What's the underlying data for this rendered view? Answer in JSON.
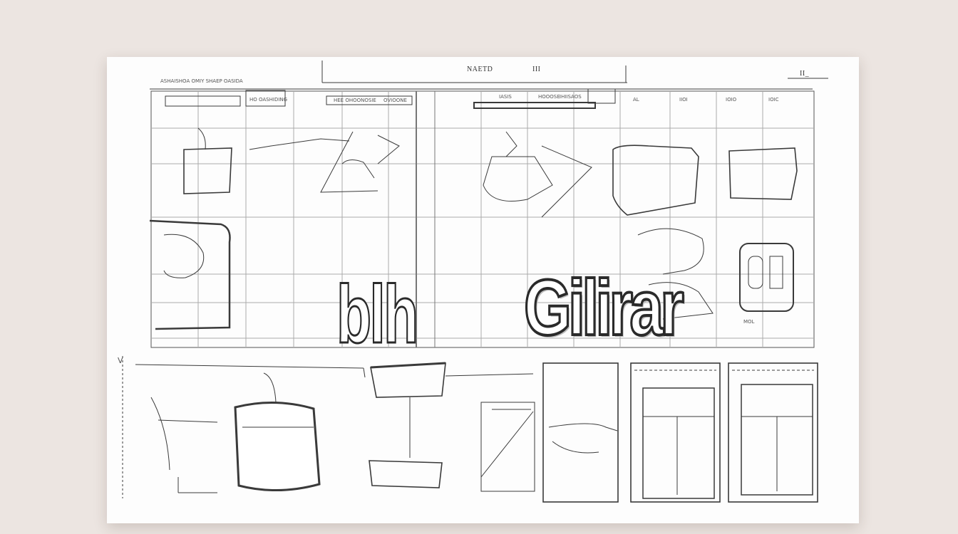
{
  "sheet": {
    "header_title": "NAETD",
    "header_code": "III",
    "corner_mark": "II_",
    "top_left_caption": "ASHAISHOA OMIY SHAEP OASIDA",
    "field_labels": [
      "HO OASHIDING",
      "HEE OHOONOSIE",
      "OVIOONE"
    ],
    "column_labels": [
      "IASIS",
      "HOOOSE",
      "IHIISAOS",
      "AL",
      "IIOI",
      "IOIO",
      "IOIC"
    ],
    "big_word": "Gilirar",
    "left_fragment": "blh",
    "footer_mark": "V",
    "small_tag": "MOL"
  }
}
